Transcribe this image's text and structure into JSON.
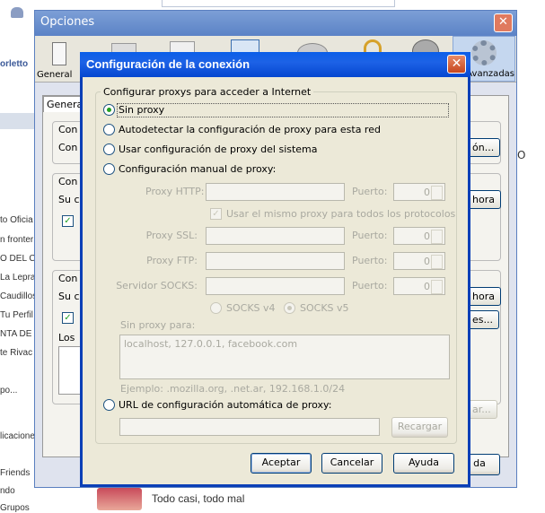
{
  "background": {
    "sidebar_items": [
      "orletto",
      "to Oficia",
      "n fronter",
      "O DEL C",
      "La Lepra",
      "Caudillos",
      "Tu Perfil",
      "NTA DE",
      "te Rivac",
      "po...",
      "licacione",
      "Friends",
      "ndo",
      "Grupos"
    ],
    "bottom_post_text": "Todo casi, todo mal",
    "right_letter": "O"
  },
  "options_window": {
    "title": "Opciones",
    "close_label": "✕",
    "tabs": [
      {
        "label": "General",
        "icon": "switch-icon"
      },
      {
        "label": "",
        "icon": "tabs-icon"
      },
      {
        "label": "",
        "icon": "content-icon"
      },
      {
        "label": "",
        "icon": "applications-icon"
      },
      {
        "label": "",
        "icon": "privacy-icon"
      },
      {
        "label": "",
        "icon": "security-icon"
      },
      {
        "label": "",
        "icon": "sync-icon"
      },
      {
        "label": "Avanzadas",
        "icon": "gear-icon"
      }
    ],
    "subtab": "General",
    "partial_labels": [
      "Con",
      "Con",
      "Con",
      "Su c",
      "Con",
      "Su c",
      "Los"
    ],
    "side_buttons": [
      "ón...",
      "hora",
      "hora",
      "es...",
      "ar..."
    ],
    "bottom_button": "da"
  },
  "dialog": {
    "title": "Configuración de la conexión",
    "close_label": "✕",
    "group_legend": "Configurar proxys para acceder a Internet",
    "options": {
      "no_proxy": "Sin proxy",
      "auto_detect": "Autodetectar la configuración de proxy para esta red",
      "system": "Usar configuración de proxy del sistema",
      "manual": "Configuración manual de proxy:",
      "auto_url": "URL de configuración automática de proxy:"
    },
    "selected": "no_proxy",
    "fields": {
      "http_label": "Proxy HTTP:",
      "ssl_label": "Proxy SSL:",
      "ftp_label": "Proxy FTP:",
      "socks_label": "Servidor SOCKS:",
      "port_label": "Puerto:",
      "port_value": "0",
      "same_proxy": "Usar el mismo proxy para todos los protocolos",
      "socks_v4": "SOCKS v4",
      "socks_v5": "SOCKS v5",
      "no_proxy_for": "Sin proxy para:",
      "no_proxy_value": "localhost, 127.0.0.1, facebook.com",
      "example": "Ejemplo: .mozilla.org, .net.ar, 192.168.1.0/24",
      "reload": "Recargar"
    },
    "buttons": {
      "ok": "Aceptar",
      "cancel": "Cancelar",
      "help": "Ayuda"
    }
  }
}
